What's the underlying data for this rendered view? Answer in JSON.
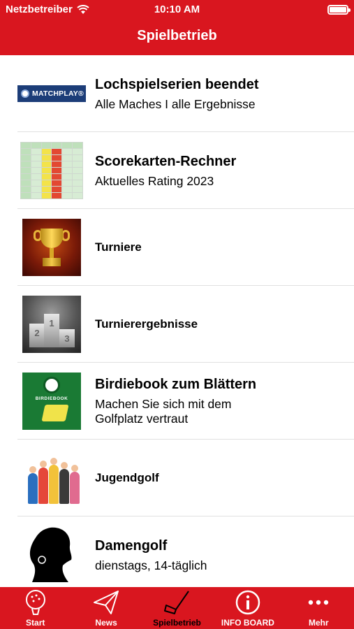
{
  "status_bar": {
    "carrier": "Netzbetreiber",
    "time": "10:10 AM",
    "battery_level": 1.0
  },
  "nav": {
    "title": "Spielbetrieb"
  },
  "items": [
    {
      "title": "Lochspielserien beendet",
      "subtitle": "Alle Maches I alle Ergebnisse",
      "thumb_text": "MATCHPLAY®"
    },
    {
      "title": "Scorekarten-Rechner",
      "subtitle": "Aktuelles Rating 2023"
    },
    {
      "title": "Turniere"
    },
    {
      "title": "Turnierergebnisse",
      "podium": [
        "2",
        "1",
        "3"
      ]
    },
    {
      "title": "Birdiebook zum Blättern",
      "subtitle_line1": "Machen Sie sich mit dem",
      "subtitle_line2": "Golfplatz vertraut",
      "thumb_text": "BIRDIEBOOK"
    },
    {
      "title": "Jugendgolf"
    },
    {
      "title": "Damengolf",
      "subtitle": "dienstags, 14-täglich"
    }
  ],
  "tabbar": {
    "tabs": [
      {
        "label": "Start",
        "icon": "golf-ball-icon"
      },
      {
        "label": "News",
        "icon": "paper-plane-icon"
      },
      {
        "label": "Spielbetrieb",
        "icon": "golf-club-icon",
        "active": true
      },
      {
        "label": "INFO BOARD",
        "icon": "info-icon"
      },
      {
        "label": "Mehr",
        "icon": "more-dots-icon"
      }
    ]
  },
  "colors": {
    "brand_red": "#d9161f",
    "active_tab": "#000000",
    "inactive_tab": "#ffffff"
  }
}
